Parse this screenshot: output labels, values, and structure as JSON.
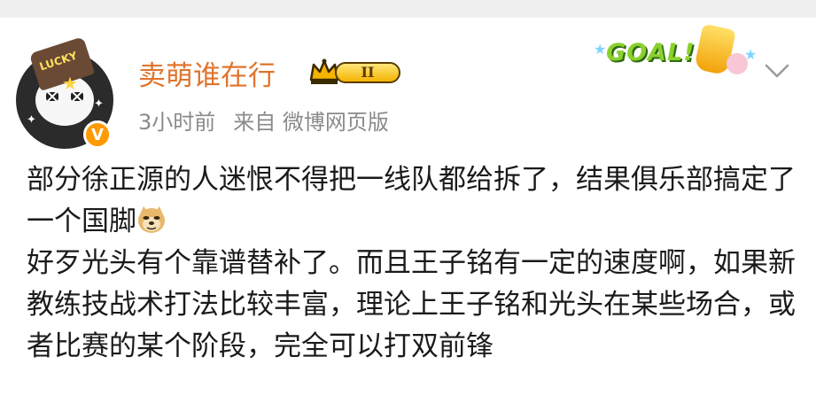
{
  "post_header": {
    "username": "卖萌谁在行",
    "level_badge": "II",
    "timestamp": "3小时前",
    "source": "来自 微博网页版",
    "avatar_hat_text": "LUCKY",
    "verified_badge": "V"
  },
  "sticker": {
    "text": "GOAL!",
    "icon": "goal-sticker-icon"
  },
  "post_body": {
    "line1": "部分徐正源的人迷恨不得把一线队都给拆了，结果俱乐部搞定了一个国脚",
    "emoji": "doge-emoji-icon",
    "line2": "好歹光头有个靠谱替补了。而且王子铭有一定的速度啊，如果新教练技战术打法比较丰富，理论上王子铭和光头在某些场合，或者比赛的某个阶段，完全可以打双前锋"
  },
  "icons": {
    "menu": "chevron-down-icon",
    "crown": "crown-icon"
  },
  "colors": {
    "username": "#e0742c",
    "meta": "#8a8a8a",
    "text": "#1a1a1a",
    "verified": "#ff9a00",
    "goal_green": "#8bd12e"
  }
}
